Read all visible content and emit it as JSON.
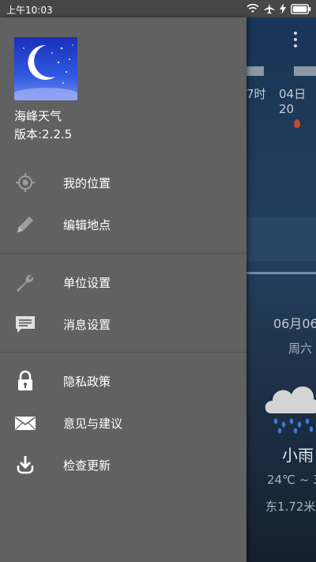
{
  "status_bar": {
    "time": "上午10:03",
    "icons": [
      "wifi-icon",
      "airplane-icon",
      "charging-icon",
      "battery-icon"
    ]
  },
  "drawer": {
    "app_logo_icon": "moon-night-icon",
    "app_name": "海峰天气",
    "app_version": "版本:2.2.5",
    "items": [
      {
        "label": "我的位置",
        "icon": "location-crosshair-icon"
      },
      {
        "label": "编辑地点",
        "icon": "pencil-icon"
      },
      {
        "label": "单位设置",
        "icon": "wrench-icon"
      },
      {
        "label": "消息设置",
        "icon": "message-icon"
      },
      {
        "label": "隐私政策",
        "icon": "lock-icon"
      },
      {
        "label": "意见与建议",
        "icon": "mail-icon"
      },
      {
        "label": "检查更新",
        "icon": "download-icon"
      }
    ]
  },
  "background_app": {
    "hourly_labels": [
      "7时",
      "04日20"
    ],
    "date": "06月06",
    "weekday": "周六",
    "condition": "小雨",
    "condition_icon": "cloud-rain-icon",
    "temperature": "24℃ ~ 3",
    "wind": "东1.72米"
  },
  "colors": {
    "drawer_bg": "#616161",
    "status_bar_bg": "#474747",
    "divider": "#525252",
    "text": "#ffffff"
  }
}
